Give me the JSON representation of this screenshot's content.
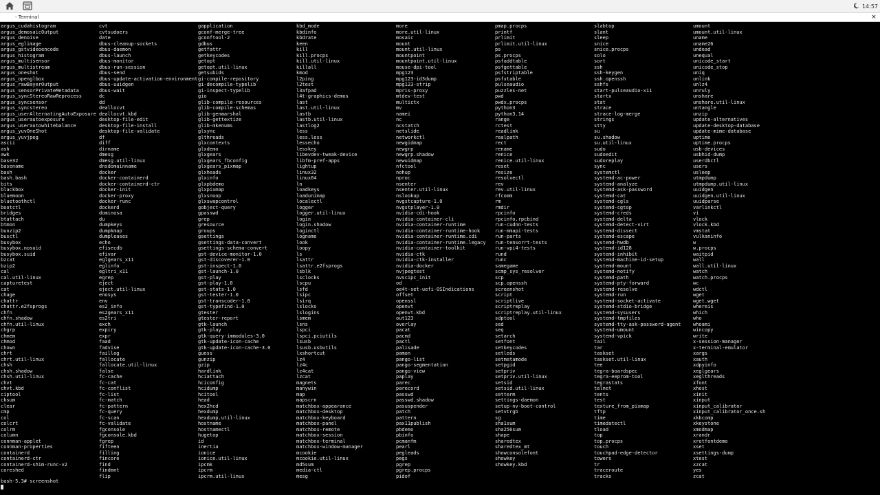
{
  "topbar": {
    "home_icon": "home-icon",
    "screenshot_icon": "screenshot-icon",
    "tray_icon": "moon-icon",
    "clock": "14:57"
  },
  "window": {
    "title": "- Terminal",
    "close_label": "×"
  },
  "terminal": {
    "columns": [
      [
        "argus_cudahistogram",
        "argus_demosaicOutput",
        "argus_denoise",
        "argus_eglimage",
        "argus_gstvideoencode",
        "argus_histogram",
        "argus_multisensor",
        "argus_multistream",
        "argus_oneshot",
        "argus_openglbox",
        "argus_rawBayerOutput",
        "argus_sensorPrivateMetadata",
        "argus_syncStereoRawReprocess",
        "argus_syncsensor",
        "argus_syncstereo",
        "argus_userAlternatingAutoExposure",
        "argus_userautoexposure",
        "argus_userautowhitebalance",
        "argus_yuvOneShot",
        "argus_yuvjpeg",
        "ascii",
        "ash",
        "awk",
        "base32",
        "basename",
        "bash",
        "bash.bash",
        "bits",
        "blackbox",
        "bluemoon",
        "bluetoothctl",
        "bootctl",
        "bridges",
        "btattach",
        "btmon",
        "bunzip2",
        "busctl",
        "busybox",
        "busybox.nosuid",
        "busybox.suid",
        "bzcat",
        "bzip2",
        "cal",
        "cal.util-linux",
        "capturetest",
        "cat",
        "chage",
        "chattr",
        "chattr.e2fsprogs",
        "chfn",
        "chfn.shadow",
        "chfn.util-linux",
        "chgrp",
        "chmem",
        "chmod",
        "chown",
        "chrt",
        "chrt.util-linux",
        "chsh",
        "chsh.shadow",
        "chsh.util-linux",
        "chvt",
        "chvt.kbd",
        "ciptool",
        "cksum",
        "clear",
        "cmp",
        "col",
        "colcrt",
        "colrm",
        "column",
        "connman-applet",
        "connman-properties",
        "containerd",
        "containerd-ctr",
        "containerd-shim-runc-v2",
        "coreshed"
      ],
      [
        "cvt",
        "cvtsudoers",
        "date",
        "dbus-cleanup-sockets",
        "dbus-daemon",
        "dbus-launch",
        "dbus-monitor",
        "dbus-run-session",
        "dbus-send",
        "dbus-update-activation-environment",
        "dbus-uuidgen",
        "dbus-wait",
        "dc",
        "dd",
        "deallocvt",
        "deallocvt.kbd",
        "desktop-file-edit",
        "desktop-file-install",
        "desktop-file-validate",
        "df",
        "diff",
        "dirname",
        "dmesg",
        "dmesg.util-linux",
        "dnsdomainname",
        "docker",
        "docker-containerd",
        "docker-containerd-ctr",
        "docker-init",
        "docker-proxy",
        "docker-runc",
        "dockerd",
        "dominosa",
        "du",
        "dumpkeys",
        "dumpkmap",
        "dumpleases",
        "echo",
        "efisecdb",
        "efivar",
        "eglgears_x11",
        "eglinfo",
        "egltri_x11",
        "egrep",
        "eject",
        "eject.util-linux",
        "enosys",
        "env",
        "es2_info",
        "es2gears_x11",
        "es2tri",
        "exch",
        "expiry",
        "expr",
        "faad",
        "fadvise",
        "faillog",
        "fallocate",
        "fallocate.util-linux",
        "false",
        "fc-cache",
        "fc-cat",
        "fc-conflist",
        "fc-list",
        "fc-match",
        "fc-pattern",
        "fc-query",
        "fc-scan",
        "fc-validate",
        "fgconsole",
        "fgconsole.kbd",
        "fgrep",
        "fifteen",
        "filling",
        "fincore",
        "find",
        "findmnt",
        "flip"
      ],
      [
        "gapplication",
        "gconf-merge-tree",
        "gconftool-2",
        "gdbus",
        "getfattr",
        "getkeycodes",
        "getopt",
        "getopt.util-linux",
        "getsubids",
        "gi-compile-repository",
        "gi-decompile-typelib",
        "gi-inspect-typelib",
        "gio",
        "glib-compile-resources",
        "glib-compile-schemas",
        "glib-genmarshal",
        "glib-gettextize",
        "glib-mkenums",
        "glsync",
        "glthreads",
        "glxcontexts",
        "glxdemo",
        "glxgears",
        "glxgears_fbconfig",
        "glxgears_pixmap",
        "glxheads",
        "glxinfo",
        "glxpbdemo",
        "glxpixmap",
        "glxsnoop",
        "glxswapcontrol",
        "gobject-query",
        "gpasswd",
        "grep",
        "gresource",
        "groups",
        "gsettings",
        "gsettings-data-convert",
        "gsettings-schema-convert",
        "gst-device-monitor-1.0",
        "gst-discoverer-1.0",
        "gst-inspect-1.0",
        "gst-launch-1.0",
        "gst-play",
        "gst-play-1.0",
        "gst-stats-1.0",
        "gst-tester-1.0",
        "gst-transcoder-1.0",
        "gst-typefind-1.0",
        "gtester",
        "gtester-report",
        "gtk-launch",
        "gtk-play",
        "gtk-query-immodules-3.0",
        "gtk-update-icon-cache",
        "gtk-update-icon-cache-3.0",
        "guess",
        "gunzip",
        "gzip",
        "hardlink",
        "hciattach",
        "hciconfig",
        "hcidump",
        "hcitool",
        "head",
        "hex2hcd",
        "hexdump",
        "hexdump.util-linux",
        "hostname",
        "hostnamectl",
        "hugetop",
        "id",
        "inertia",
        "ionice",
        "ionice.util-linux",
        "ipcmk",
        "ipcrm",
        "ipcrm.util-linux"
      ],
      [
        "kbd_mode",
        "kbdinfo",
        "kbdrate",
        "keen",
        "kill",
        "kill.procps",
        "kill.util-linux",
        "killall",
        "kmod",
        "l2ping",
        "l2test",
        "l3afpad",
        "l4t-graphics-demos",
        "last",
        "last.util-linux",
        "lastb",
        "lastb.util-linux",
        "lastlog2",
        "less",
        "less.less",
        "lessecho",
        "lesskey",
        "libevdev-tweak-device",
        "libfm-pref-apps",
        "lightup",
        "linux32",
        "linux64",
        "ln",
        "loadkeys",
        "loadunimap",
        "localectl",
        "logger",
        "logger.util-linux",
        "login",
        "login.shadow",
        "loginctl",
        "logname",
        "look",
        "loopy",
        "ls",
        "lsattr",
        "lsattr.e2fsprogs",
        "lsblk",
        "lsclocks",
        "lscpu",
        "lsfd",
        "lsipc",
        "lsirq",
        "lslocks",
        "lslogins",
        "lsmem",
        "lsns",
        "lspci",
        "lspci.pciutils",
        "lsusb",
        "lsusb.usbutils",
        "lxshortcut",
        "lz4",
        "lz4c",
        "lz4cat",
        "lzcat",
        "magnets",
        "manywin",
        "map",
        "mapscrn",
        "matchbox-appearance",
        "matchbox-desktop",
        "matchbox-keyboard",
        "matchbox-panel",
        "matchbox-remote",
        "matchbox-session",
        "matchbox-terminal",
        "matchbox-window-manager",
        "mcookie",
        "mcookie.util-linux",
        "md5sum",
        "media-ctl",
        "mesg"
      ],
      [
        "more",
        "more.util-linux",
        "mosaic",
        "mount",
        "mount.util-linux",
        "mountpoint",
        "mountpoint.util-linux",
        "mouse-dpi-tool",
        "mpg123",
        "mpg123-id3dump",
        "mpg123-strip",
        "mpris-proxy",
        "mtdev-test",
        "multictx",
        "mv",
        "namei",
        "nc",
        "ncstatch",
        "netslide",
        "networkctl",
        "newgidmap",
        "newgrp",
        "newgrp.shadow",
        "newuidmap",
        "nfctool",
        "nohup",
        "nproc",
        "nsenter",
        "nsenter.util-linux",
        "nslookup",
        "nvgstcapture-1.0",
        "nvgstplayer-1.0",
        "nvidia-cdi-hook",
        "nvidia-container-cli",
        "nvidia-container-runtime",
        "nvidia-container-runtime-hook",
        "nvidia-container-runtime.cdi",
        "nvidia-container-runtime.legacy",
        "nvidia-container-toolkit",
        "nvidia-ctk",
        "nvidia-ctk-installer",
        "nvidia-docker",
        "nvjpegtest",
        "nvscipc_init",
        "od",
        "oe4t-set-uefi-OSIndications",
        "offset",
        "openssl",
        "openvt",
        "openvt.kbd",
        "out123",
        "overlay",
        "pacat",
        "pacmd",
        "pactl",
        "palisade",
        "pamon",
        "pango-list",
        "pango-segmentation",
        "pango-view",
        "paplay",
        "parec",
        "parecord",
        "passwd",
        "passwd.shadow",
        "pasuspender",
        "patch",
        "pattern",
        "pax11publish",
        "pbdemo",
        "pbinfo",
        "pcmanfm",
        "pearl",
        "pegleads",
        "pegs",
        "pgrep",
        "pgrep.procps",
        "pidof"
      ],
      [
        "pmap.procps",
        "printf",
        "prlimit",
        "prlimit.util-linux",
        "ps",
        "ps.procps",
        "psfaddtable",
        "psfgettable",
        "psfstriptable",
        "psfxtable",
        "pulseaudio",
        "puzzles-net",
        "pwd",
        "pwdx.procps",
        "python3",
        "python3.14",
        "range",
        "rctest",
        "readlink",
        "realpath",
        "rect",
        "rename",
        "renice",
        "renice.util-linux",
        "reset",
        "resize",
        "resolvectl",
        "rev",
        "rev.util-linux",
        "rfcomm",
        "rm",
        "rmdir",
        "rpcinfo",
        "rpcinfo.rpcbind",
        "run-cudnn-tests",
        "run-mmapi-tests",
        "run-parts",
        "run-tensorrt-tests",
        "run-vpi4-tests",
        "rund",
        "runc",
        "samegame",
        "scmp_sys_resolver",
        "scp",
        "scp.openssh",
        "screenshot",
        "script",
        "scriptlive",
        "scriptreplay",
        "scriptreplay.util-linux",
        "sdptool",
        "sed",
        "seq",
        "setarch",
        "setfont",
        "setkeycodes",
        "setleds",
        "setmetamode",
        "setpgid",
        "setpriv",
        "setpriv.util-linux",
        "setsid",
        "setsid.util-linux",
        "setterm",
        "settings-daemon",
        "setup-nv-boot-control",
        "setvtrgb",
        "sg",
        "sha1sum",
        "sha256sum",
        "shape",
        "sharedtex",
        "sharedtex_mt",
        "showconsolefont",
        "showkey",
        "showkey.kbd"
      ],
      [
        "slabtop",
        "slant",
        "sleep",
        "snice",
        "snice.procps",
        "solo",
        "sort",
        "ssh",
        "ssh-keygen",
        "ssh.openssh",
        "sshfs",
        "start-pulseaudio-x11",
        "startx",
        "stat",
        "strace",
        "strace-log-merge",
        "strings",
        "stty",
        "su",
        "su.shadow",
        "su.util-linux",
        "sudo",
        "sudoedit",
        "sudoreplay",
        "sync",
        "systemctl",
        "systemd-ac-power",
        "systemd-analyze",
        "systemd-ask-password",
        "systemd-cat",
        "systemd-cgls",
        "systemd-cgtop",
        "systemd-creds",
        "systemd-delta",
        "systemd-detect-virt",
        "systemd-dissect",
        "systemd-escape",
        "systemd-hwdb",
        "systemd-id128",
        "systemd-inhibit",
        "systemd-machine-id-setup",
        "systemd-mount",
        "systemd-notify",
        "systemd-path",
        "systemd-pty-forward",
        "systemd-resolve",
        "systemd-run",
        "systemd-socket-activate",
        "systemd-stdio-bridge",
        "systemd-sysusers",
        "systemd-tmpfiles",
        "systemd-tty-ask-password-agent",
        "systemd-umount",
        "systemd-vpick",
        "tail",
        "tar",
        "taskset",
        "taskset.util-linux",
        "tee",
        "tegra-boardspec",
        "tegra-eeprom-tool",
        "tegrastats",
        "telnet",
        "tents",
        "test",
        "texture_from_pixmap",
        "tftp",
        "time",
        "timedatectl",
        "tload",
        "top",
        "top.procps",
        "touch",
        "touchpad-edge-detector",
        "towers",
        "tr",
        "traceroute",
        "tracks"
      ],
      [
        "umount",
        "umount.util-linux",
        "uname",
        "uname26",
        "undead",
        "unequal",
        "unicode_start",
        "unicode_stop",
        "uniq",
        "unlink",
        "unlz4",
        "unruly",
        "unshare",
        "unshare.util-linux",
        "untangle",
        "unzip",
        "update-alternatives",
        "update-desktop-database",
        "update-mime-database",
        "uptime",
        "uptime.procps",
        "usb-devices",
        "usbhid-dump",
        "userdbctl",
        "users",
        "usleep",
        "utmpdump",
        "utmpdump.util-linux",
        "uuidgen",
        "uuidgen.util-linux",
        "uuidparse",
        "varlinkctl",
        "vi",
        "vlock",
        "vlock.kbd",
        "vmstat",
        "vulkaninfo",
        "w",
        "w.procps",
        "waitpid",
        "wall",
        "wall.util-linux",
        "watch",
        "watch.procps",
        "wc",
        "wdctl",
        "wget",
        "wget.wget",
        "whereis",
        "which",
        "who",
        "whoami",
        "wincopy",
        "write",
        "x-session-manager",
        "x-terminal-emulator",
        "xargs",
        "xauth",
        "xdpyinfo",
        "xeglgears",
        "xeglthreads",
        "xfont",
        "xhost",
        "xinit",
        "xinput",
        "xinput_calibrator",
        "xinput_calibrator_once.sh",
        "xkbcomp",
        "xkeystone",
        "xmodmap",
        "xrandr",
        "xrotfontdemo",
        "xset",
        "xsettings-dump",
        "xtest",
        "xzcat",
        "yes",
        "zcat"
      ]
    ],
    "prompt": "bash-5.3# screenshot"
  }
}
